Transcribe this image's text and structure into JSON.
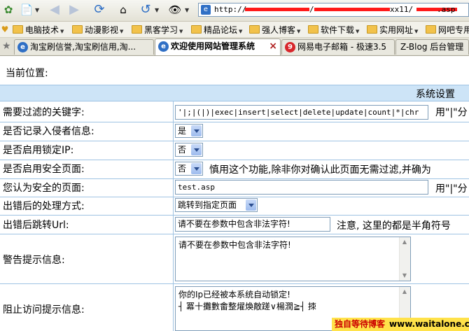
{
  "toolbar": {
    "address_prefix": "http://",
    "address_mid1": "/",
    "address_mid2": "xx11/",
    "address_suffix": ".asp"
  },
  "bookmarks": [
    "电脑技术",
    "动漫影视",
    "黑客学习",
    "精品论坛",
    "强人博客",
    "软件下载",
    "实用网址",
    "网吧专用"
  ],
  "tabs": [
    {
      "label": "淘宝刷信誉,淘宝刷信用,淘...",
      "active": false
    },
    {
      "label": "欢迎使用网站管理系统",
      "active": true
    },
    {
      "label": "网易电子邮箱 - 极速3.5",
      "active": false
    },
    {
      "label": "Z-Blog 后台管理",
      "active": false
    }
  ],
  "page": {
    "location_label": "当前位置:",
    "section_title": "系统设置"
  },
  "form": {
    "keywords_label": "需要过滤的关键字:",
    "keywords_value": "'|;|(|)|exec|insert|select|delete|update|count|*|chr",
    "keywords_note": "用\"|\"分",
    "log_label": "是否记录入侵者信息:",
    "log_value": "是",
    "lockip_label": "是否启用锁定IP:",
    "lockip_value": "否",
    "safepage_label": "是否启用安全页面:",
    "safepage_value": "否",
    "safepage_note": "慎用这个功能,除非你对确认此页面无需过滤,并确为",
    "safepages_label": "您认为安全的页面:",
    "safepages_value": "test.asp",
    "safepages_note": "用\"|\"分",
    "action_label": "出错后的处理方式:",
    "action_value": "跳转到指定页面",
    "url_label": "出错后跳转Url:",
    "url_value": "请不要在参数中包含非法字符!",
    "url_note": "注意, 这里的都是半角符号",
    "warn_label": "警告提示信息:",
    "warn_value": "请不要在参数中包含非法字符!",
    "block_label": "阻止访问提示信息:",
    "block_line1": "你的Ip已经被本系统自动锁定!",
    "block_line2": "┤ 冪十攤數畬整燿煥敵蹉∨楊潤≧┤ 拺"
  },
  "watermark": {
    "name": "独自等待博客",
    "url": "www.waitalone.cn"
  }
}
